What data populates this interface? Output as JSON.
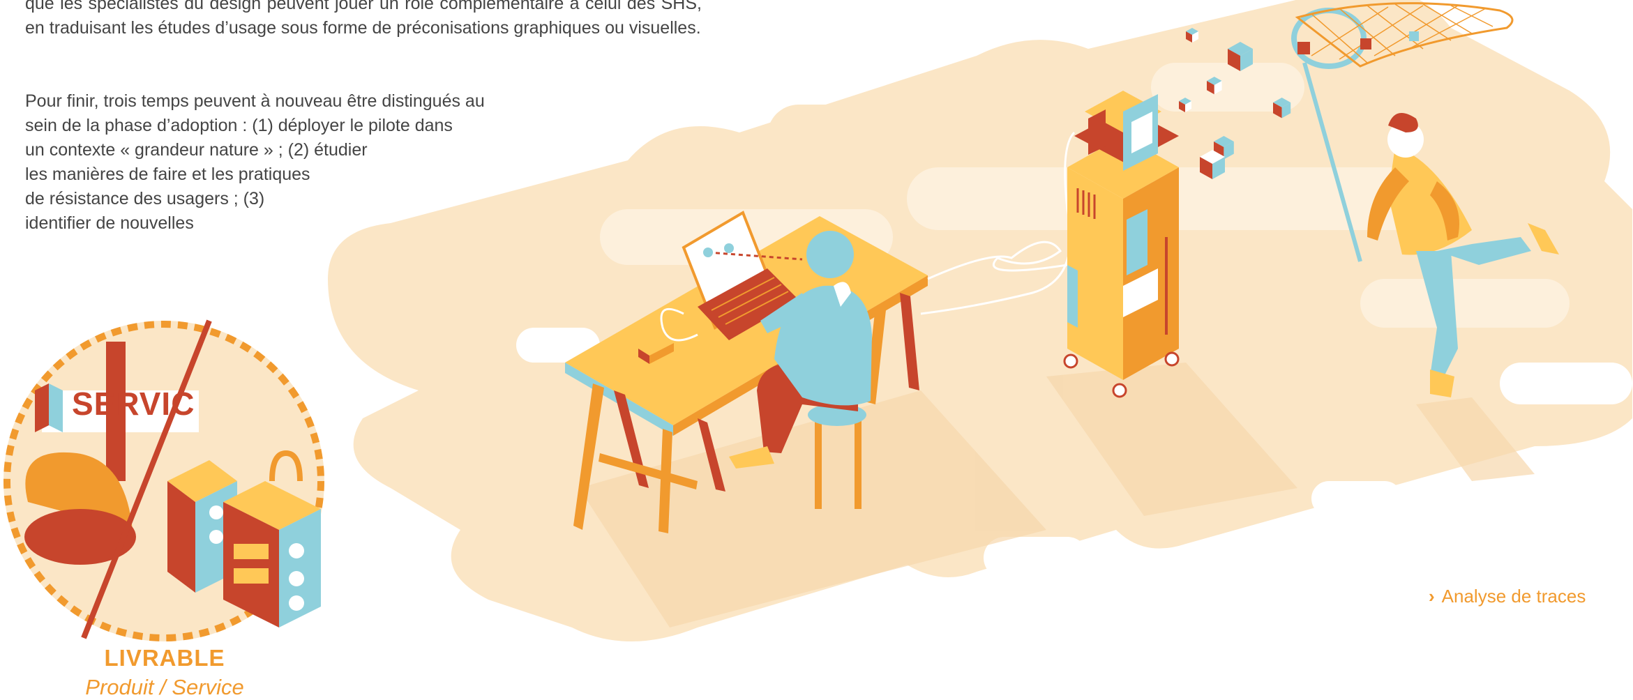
{
  "text": {
    "paragraph1": "que les spécialistes du design peuvent jouer un rôle complémentaire à celui des SHS, en traduisant les études d’usage sous forme de préconisations graphiques ou visuelles.",
    "paragraph2_lines": [
      "Pour finir, trois temps peuvent à nouveau être distingués au",
      "sein de la phase d’adoption : (1) déployer le pilote dans",
      "un contexte « grandeur nature » ; (2) étudier",
      "les manières de faire et les pratiques",
      "de résistance des usagers ; (3)",
      "identifier de nouvelles"
    ]
  },
  "badge": {
    "label": "SERVIC",
    "caption_title": "LIVRABLE",
    "caption_subtitle": "Produit / Service"
  },
  "link": {
    "chevron": "›",
    "label": "Analyse de traces"
  },
  "colors": {
    "cream": "#fbe6c6",
    "yellow": "#ffc857",
    "orange": "#f19a2e",
    "red": "#c7452c",
    "blue": "#8fd0dc",
    "white": "#ffffff"
  }
}
